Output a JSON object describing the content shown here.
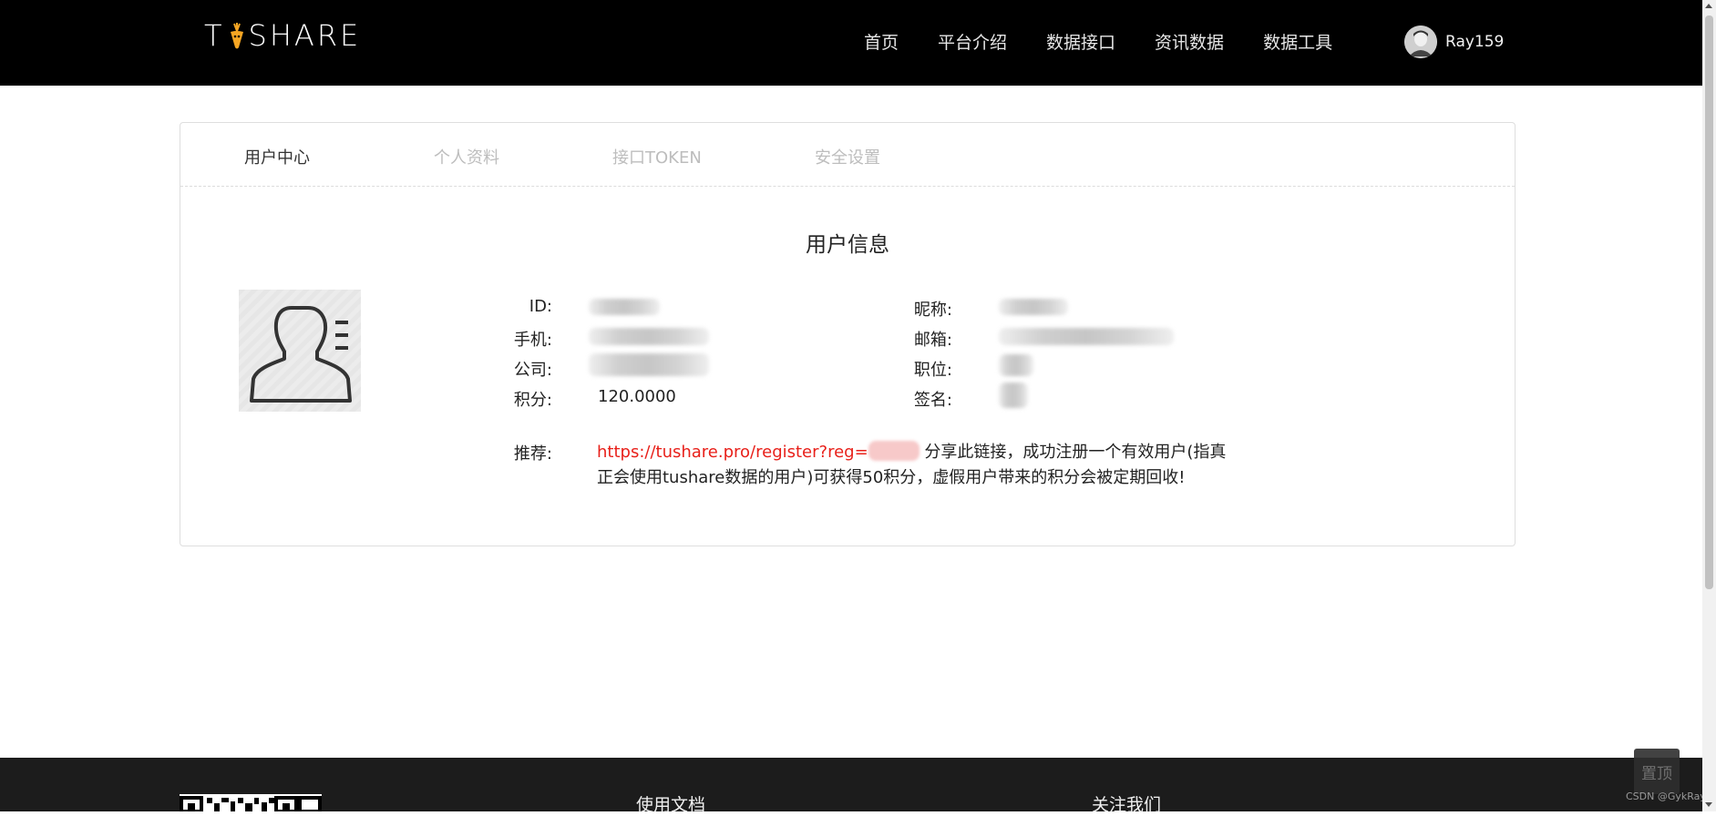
{
  "header": {
    "logo_text": "TUSHARE",
    "nav": [
      "首页",
      "平台介绍",
      "数据接口",
      "资讯数据",
      "数据工具"
    ],
    "username": "Ray159"
  },
  "tabs": [
    {
      "label": "用户中心",
      "active": true
    },
    {
      "label": "个人资料",
      "active": false
    },
    {
      "label": "接口TOKEN",
      "active": false
    },
    {
      "label": "安全设置",
      "active": false
    }
  ],
  "user_info": {
    "title": "用户信息",
    "labels": {
      "id": "ID:",
      "phone": "手机:",
      "company": "公司:",
      "points": "积分:",
      "nickname": "昵称:",
      "email": "邮箱:",
      "position": "职位:",
      "signature": "签名:",
      "referral": "推荐:"
    },
    "points_value": "120.0000",
    "referral_link": "https://tushare.pro/register?reg=",
    "referral_note": "分享此链接，成功注册一个有效用户(指真正会使用tushare数据的用户)可获得50积分，虚假用户带来的积分会被定期回收!"
  },
  "footer": {
    "col1": "使用文档",
    "col2": "关注我们",
    "back_to_top": "置顶",
    "watermark": "CSDN @GykRay"
  },
  "colors": {
    "header_bg": "#000000",
    "footer_bg": "#1c1c1c",
    "link_red": "#e8201a"
  }
}
